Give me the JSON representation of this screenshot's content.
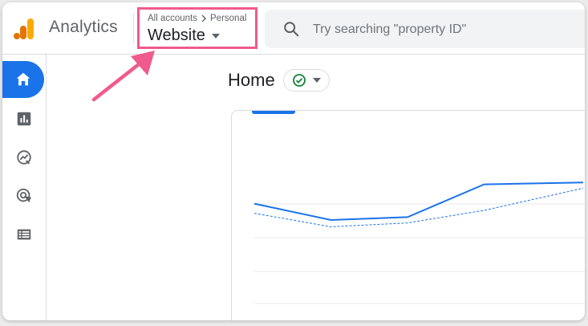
{
  "header": {
    "app_title": "Analytics",
    "breadcrumb": {
      "accounts": "All accounts",
      "account": "Personal"
    },
    "property": "Website",
    "search_placeholder": "Try searching \"property ID\""
  },
  "sidebar": {
    "items": [
      {
        "name": "home",
        "icon": "home-icon",
        "active": true
      },
      {
        "name": "reports",
        "icon": "reports-icon",
        "active": false
      },
      {
        "name": "explore",
        "icon": "explore-icon",
        "active": false
      },
      {
        "name": "advertising",
        "icon": "advertising-icon",
        "active": false
      },
      {
        "name": "configure",
        "icon": "list-icon",
        "active": false
      }
    ]
  },
  "main": {
    "page_title": "Home",
    "status_icon": "check-circle-icon"
  },
  "colors": {
    "accent": "#1a73e8",
    "highlight": "#f05a8c",
    "logo_orange": "#f9ab00",
    "logo_dark_orange": "#e37400",
    "status_green": "#188038"
  },
  "chart_data": {
    "type": "line",
    "series": [
      {
        "values": [
          0.62,
          0.45,
          0.48,
          0.82,
          0.84
        ],
        "style": "solid"
      },
      {
        "values": [
          0.52,
          0.38,
          0.42,
          0.55,
          0.78
        ],
        "style": "dashed"
      }
    ],
    "grid": true
  }
}
